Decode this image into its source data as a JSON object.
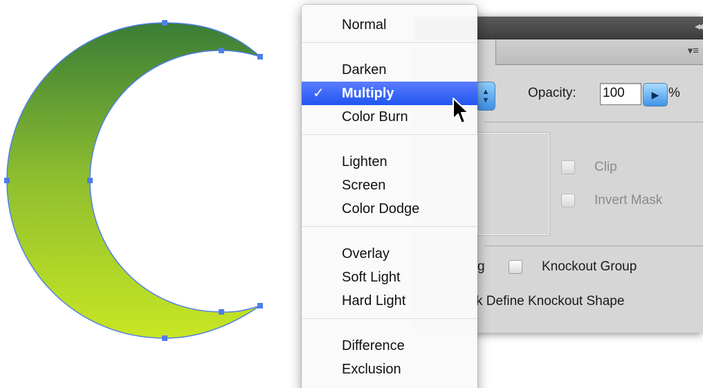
{
  "artwork": {
    "gradient_top_color": "#3a7d37",
    "gradient_bottom_color": "#c8e623",
    "selection_color": "#4f7ee8"
  },
  "blend_menu": {
    "selected_item": "Multiply",
    "check_glyph": "✓",
    "groups": [
      [
        "Normal"
      ],
      [
        "Darken",
        "Multiply",
        "Color Burn"
      ],
      [
        "Lighten",
        "Screen",
        "Color Dodge"
      ],
      [
        "Overlay",
        "Soft Light",
        "Hard Light"
      ],
      [
        "Difference",
        "Exclusion"
      ]
    ]
  },
  "transparency_panel": {
    "opacity_label": "Opacity:",
    "opacity_value": "100",
    "opacity_unit": "%",
    "clip_label": "Clip",
    "invert_mask_label": "Invert Mask",
    "isolate_blending_label_fragment": "g",
    "knockout_group_label": "Knockout Group",
    "define_knockout_label_fragment": "k Define Knockout Shape",
    "panel_menu_icon": "panel-menu-icon",
    "collapse_icon": "double-chevron-icon"
  }
}
